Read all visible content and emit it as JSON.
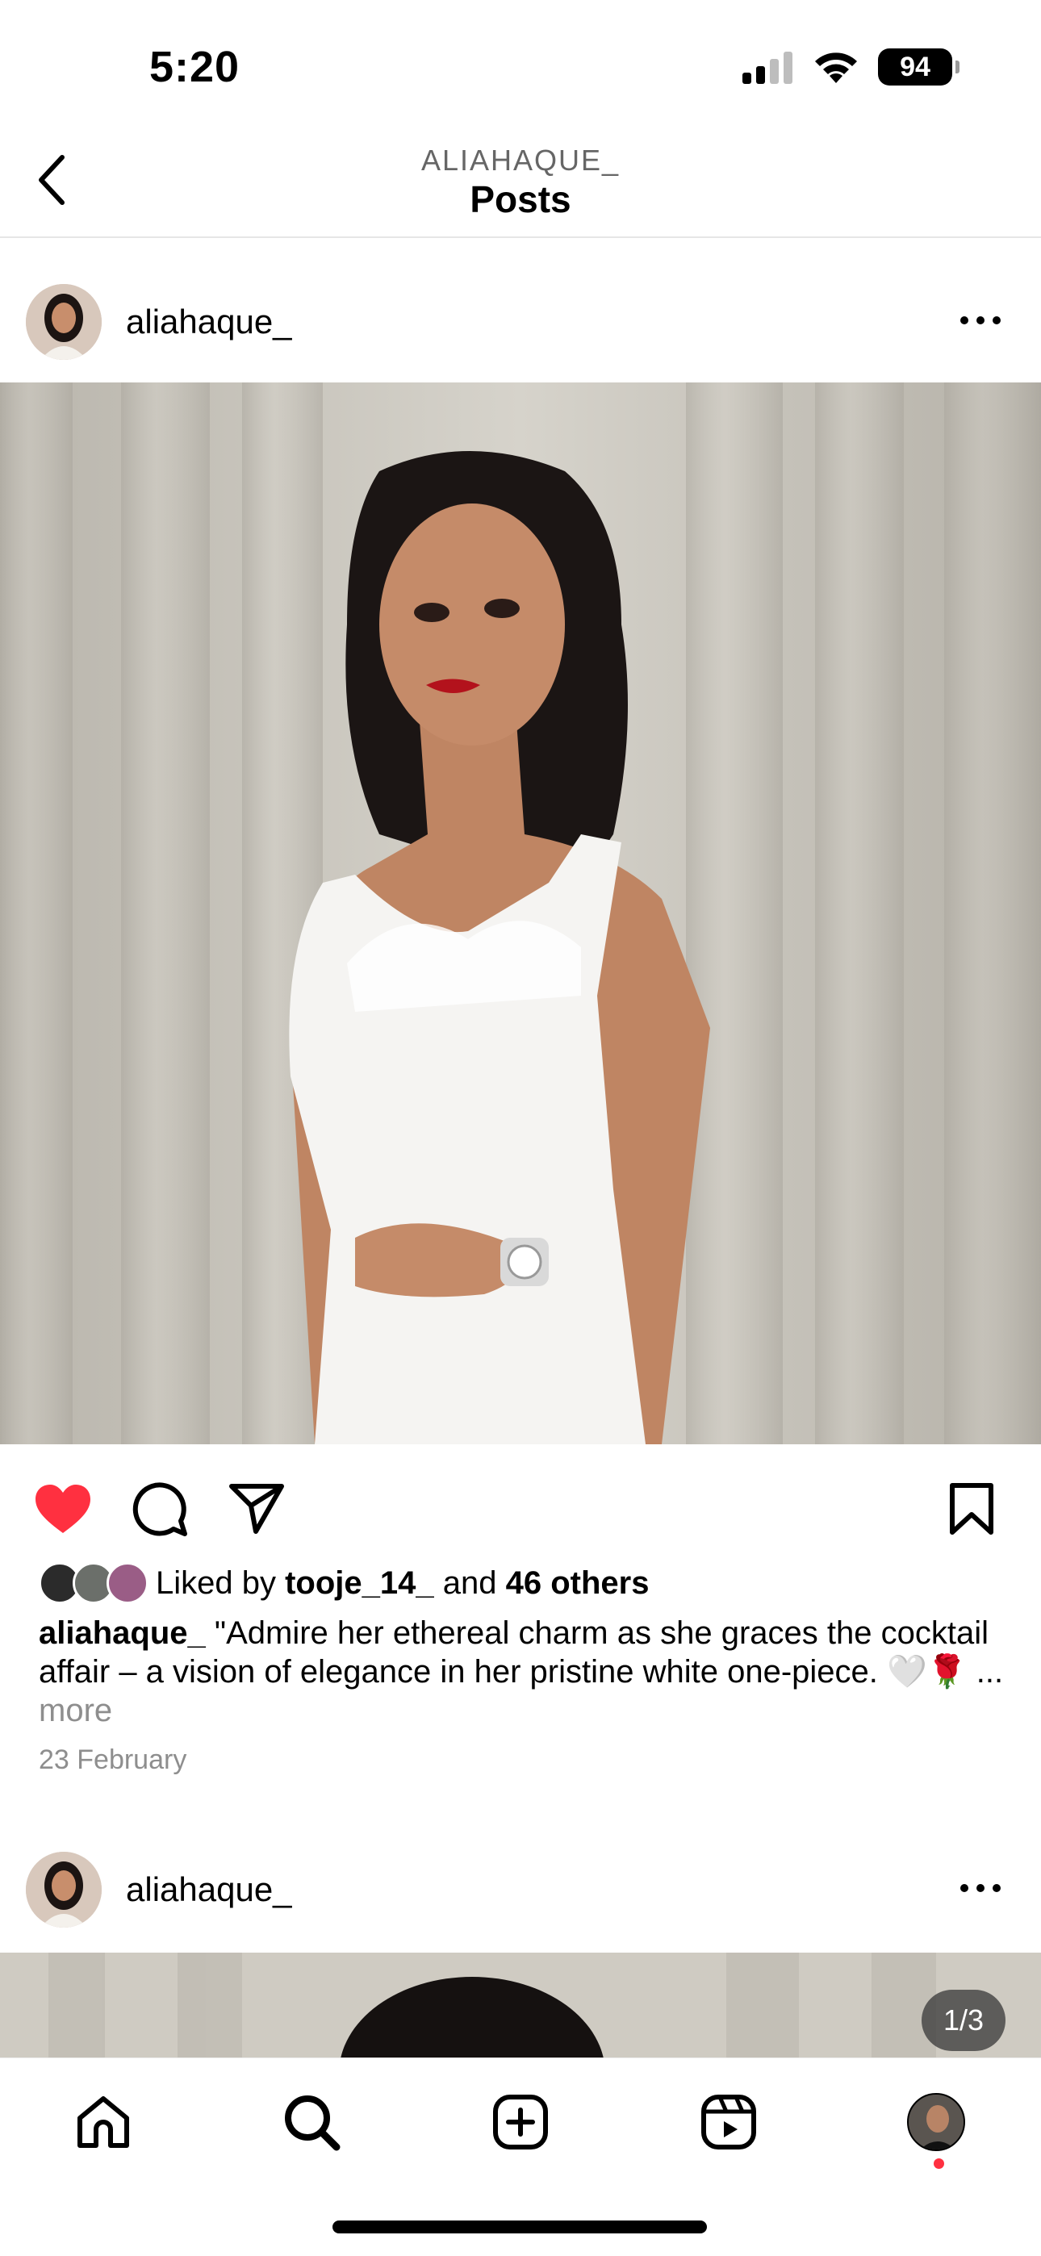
{
  "status_bar": {
    "time": "5:20",
    "battery": "94"
  },
  "header": {
    "subtitle": "ALIAHAQUE_",
    "title": "Posts"
  },
  "post": {
    "username": "aliahaque_",
    "liked": true,
    "likes_prefix": "Liked by ",
    "liked_by_user": "tooje_14_",
    "likes_mid": " and ",
    "likes_others": "46 others",
    "caption_user": "aliahaque_",
    "caption_text": " \"Admire her ethereal charm as she graces the cocktail affair – a vision of elegance in her pristine white one-piece. 🤍🌹",
    "caption_ellipsis": "... ",
    "more_label": "more",
    "date": "23 February"
  },
  "post2": {
    "username": "aliahaque_",
    "counter": "1/3"
  },
  "colors": {
    "like_red": "#ff3040",
    "secondary_text": "#8e8e8e"
  },
  "tab_bar": {
    "items": [
      "home-icon",
      "search-icon",
      "create-icon",
      "reels-icon",
      "profile-avatar"
    ]
  }
}
